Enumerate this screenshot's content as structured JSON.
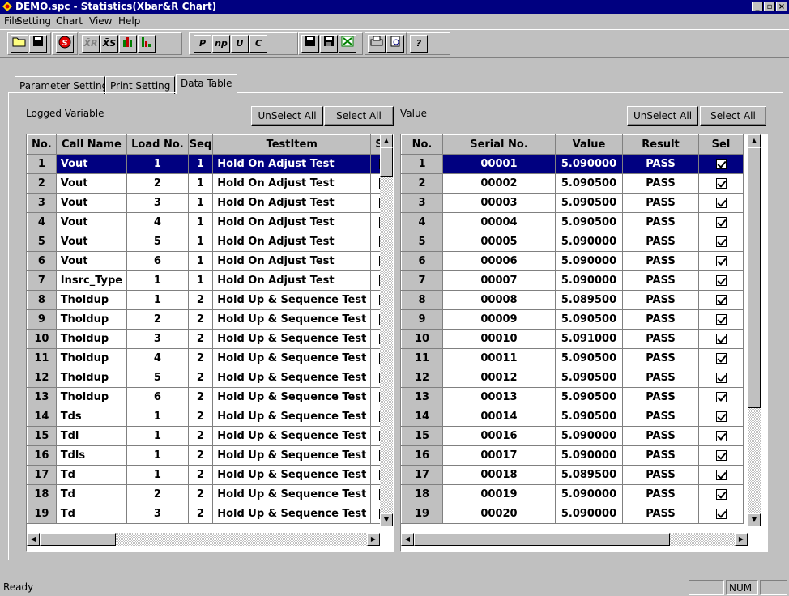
{
  "window": {
    "title": "DEMO.spc - Statistics(Xbar&R Chart)"
  },
  "menu": [
    "File",
    "Setting",
    "Chart",
    "View",
    "Help"
  ],
  "toolbar": {
    "p": "P",
    "np": "np",
    "u": "U",
    "c": "C",
    "help": "?"
  },
  "tabs": [
    "Parameter Setting",
    "Print Setting",
    "Data Table"
  ],
  "left": {
    "label": "Logged Variable",
    "unselect": "UnSelect All",
    "select": "Select All",
    "headers": [
      "No.",
      "Call Name",
      "Load No.",
      "Seq",
      "TestItem",
      "Sel"
    ],
    "rows": [
      [
        "1",
        "Vout",
        "1",
        "1",
        "Hold On Adjust Test",
        true
      ],
      [
        "2",
        "Vout",
        "2",
        "1",
        "Hold On Adjust Test",
        false
      ],
      [
        "3",
        "Vout",
        "3",
        "1",
        "Hold On Adjust Test",
        false
      ],
      [
        "4",
        "Vout",
        "4",
        "1",
        "Hold On Adjust Test",
        false
      ],
      [
        "5",
        "Vout",
        "5",
        "1",
        "Hold On Adjust Test",
        false
      ],
      [
        "6",
        "Vout",
        "6",
        "1",
        "Hold On Adjust Test",
        false
      ],
      [
        "7",
        "Insrc_Type",
        "1",
        "1",
        "Hold On Adjust Test",
        false
      ],
      [
        "8",
        "Tholdup",
        "1",
        "2",
        "Hold Up & Sequence Test",
        false
      ],
      [
        "9",
        "Tholdup",
        "2",
        "2",
        "Hold Up & Sequence Test",
        false
      ],
      [
        "10",
        "Tholdup",
        "3",
        "2",
        "Hold Up & Sequence Test",
        false
      ],
      [
        "11",
        "Tholdup",
        "4",
        "2",
        "Hold Up & Sequence Test",
        false
      ],
      [
        "12",
        "Tholdup",
        "5",
        "2",
        "Hold Up & Sequence Test",
        false
      ],
      [
        "13",
        "Tholdup",
        "6",
        "2",
        "Hold Up & Sequence Test",
        false
      ],
      [
        "14",
        "Tds",
        "1",
        "2",
        "Hold Up & Sequence Test",
        false
      ],
      [
        "15",
        "Tdl",
        "1",
        "2",
        "Hold Up & Sequence Test",
        false
      ],
      [
        "16",
        "Tdls",
        "1",
        "2",
        "Hold Up & Sequence Test",
        false
      ],
      [
        "17",
        "Td",
        "1",
        "2",
        "Hold Up & Sequence Test",
        false
      ],
      [
        "18",
        "Td",
        "2",
        "2",
        "Hold Up & Sequence Test",
        false
      ],
      [
        "19",
        "Td",
        "3",
        "2",
        "Hold Up & Sequence Test",
        false
      ]
    ]
  },
  "right": {
    "label": "Value",
    "unselect": "UnSelect All",
    "select": "Select All",
    "headers": [
      "No.",
      "Serial No.",
      "Value",
      "Result",
      "Sel"
    ],
    "rows": [
      [
        "1",
        "00001",
        "5.090000",
        "PASS",
        true
      ],
      [
        "2",
        "00002",
        "5.090500",
        "PASS",
        true
      ],
      [
        "3",
        "00003",
        "5.090500",
        "PASS",
        true
      ],
      [
        "4",
        "00004",
        "5.090500",
        "PASS",
        true
      ],
      [
        "5",
        "00005",
        "5.090000",
        "PASS",
        true
      ],
      [
        "6",
        "00006",
        "5.090000",
        "PASS",
        true
      ],
      [
        "7",
        "00007",
        "5.090000",
        "PASS",
        true
      ],
      [
        "8",
        "00008",
        "5.089500",
        "PASS",
        true
      ],
      [
        "9",
        "00009",
        "5.090500",
        "PASS",
        true
      ],
      [
        "10",
        "00010",
        "5.091000",
        "PASS",
        true
      ],
      [
        "11",
        "00011",
        "5.090500",
        "PASS",
        true
      ],
      [
        "12",
        "00012",
        "5.090500",
        "PASS",
        true
      ],
      [
        "13",
        "00013",
        "5.090500",
        "PASS",
        true
      ],
      [
        "14",
        "00014",
        "5.090500",
        "PASS",
        true
      ],
      [
        "15",
        "00016",
        "5.090000",
        "PASS",
        true
      ],
      [
        "16",
        "00017",
        "5.090000",
        "PASS",
        true
      ],
      [
        "17",
        "00018",
        "5.089500",
        "PASS",
        true
      ],
      [
        "18",
        "00019",
        "5.090000",
        "PASS",
        true
      ],
      [
        "19",
        "00020",
        "5.090000",
        "PASS",
        true
      ]
    ]
  },
  "status": {
    "text": "Ready",
    "num": "NUM"
  },
  "colors": {
    "titlebar": "#000080",
    "selection": "#000080",
    "face": "#c0c0c0"
  }
}
